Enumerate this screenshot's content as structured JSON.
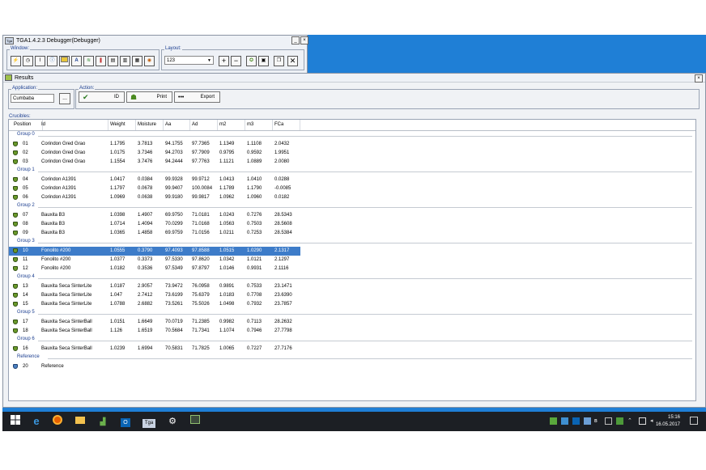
{
  "debugger": {
    "title": "TGA1.4.2.3 Debugger(Debugger)",
    "window_group_label": "Window:",
    "layout_group_label": "Layout:",
    "layout_value": "123",
    "toolbar_icons": [
      "lightning-icon",
      "clock-icon",
      "chart-icon",
      "info-icon",
      "yellow-box-icon",
      "text-a-icon",
      "signal-icon",
      "thermometer-icon",
      "page-icon",
      "document-icon",
      "document-list-icon",
      "gauge-icon"
    ],
    "layout_icons": [
      "plus-icon",
      "minus-icon",
      "gear-icon",
      "window-icon",
      "cascade-icon",
      "close-x-icon"
    ]
  },
  "results": {
    "title": "Results",
    "application_label": "Application:",
    "application_value": "Cumbaba",
    "application_button": "...",
    "action_label": "Action:",
    "actions": [
      {
        "icon": "checkmark-icon",
        "label": "ID"
      },
      {
        "icon": "printer-icon",
        "label": "Print"
      },
      {
        "icon": "ellipsis-icon",
        "label": "Export"
      }
    ],
    "crucibles_label": "Crucibles:",
    "columns": [
      "Position",
      "Id",
      "Weight",
      "Moisture",
      "Aa",
      "Ad",
      "m2",
      "m3",
      "FCa"
    ],
    "groups": [
      {
        "name": "Group 0",
        "rows": [
          [
            "01",
            "Corindon Gred Grao",
            "1.1795",
            "3.7813",
            "94.1755",
            "97.7365",
            "1.1349",
            "1.1108",
            "2.0432"
          ],
          [
            "02",
            "Corindon Gred Grao",
            "1.0175",
            "3.7346",
            "94.2703",
            "97.7909",
            "0.9795",
            "0.9592",
            "1.9951"
          ],
          [
            "03",
            "Corindon Gred Grao",
            "1.1554",
            "3.7476",
            "94.2444",
            "97.7763",
            "1.1121",
            "1.0889",
            "2.0080"
          ]
        ]
      },
      {
        "name": "Group 1",
        "rows": [
          [
            "04",
            "Corindon A1391",
            "1.0417",
            "0.0384",
            "99.9328",
            "99.9712",
            "1.0413",
            "1.0410",
            "0.0288"
          ],
          [
            "05",
            "Corindon A1391",
            "1.1797",
            "0.0678",
            "99.9407",
            "100.0084",
            "1.1789",
            "1.1790",
            "-0.0085"
          ],
          [
            "06",
            "Corindon A1391",
            "1.0969",
            "0.0638",
            "99.9180",
            "99.9817",
            "1.0962",
            "1.0960",
            "0.0182"
          ]
        ]
      },
      {
        "name": "Group 2",
        "rows": [
          [
            "07",
            "Bauxita B3",
            "1.0398",
            "1.4907",
            "69.9750",
            "71.0181",
            "1.0243",
            "0.7276",
            "28.5343"
          ],
          [
            "08",
            "Bauxita B3",
            "1.0714",
            "1.4094",
            "70.0299",
            "71.0168",
            "1.0563",
            "0.7503",
            "28.5608"
          ],
          [
            "09",
            "Bauxita B3",
            "1.0365",
            "1.4858",
            "69.9759",
            "71.0156",
            "1.0211",
            "0.7253",
            "28.5384"
          ]
        ]
      },
      {
        "name": "Group 3",
        "rows": [
          [
            "10",
            "Fonolito #200",
            "1.0555",
            "0.3790",
            "97.4093",
            "97.8588",
            "1.0515",
            "1.0290",
            "2.1317"
          ],
          [
            "11",
            "Fonolito #200",
            "1.0377",
            "0.3373",
            "97.5330",
            "97.8620",
            "1.0342",
            "1.0121",
            "2.1297"
          ],
          [
            "12",
            "Fonolito #200",
            "1.0182",
            "0.3536",
            "97.5349",
            "97.8797",
            "1.0146",
            "0.9931",
            "2.1116"
          ]
        ]
      },
      {
        "name": "Group 4",
        "rows": [
          [
            "13",
            "Bauxita Seca SinterLite",
            "1.0187",
            "2.9057",
            "73.9472",
            "76.0958",
            "0.9891",
            "0.7533",
            "23.1471"
          ],
          [
            "14",
            "Bauxita Seca SinterLite",
            "1.047",
            "2.7412",
            "73.6199",
            "75.6379",
            "1.0183",
            "0.7708",
            "23.6390"
          ],
          [
            "15",
            "Bauxita Seca SinterLite",
            "1.0788",
            "2.6882",
            "73.5261",
            "75.5026",
            "1.0498",
            "0.7932",
            "23.7857"
          ]
        ]
      },
      {
        "name": "Group 5",
        "rows": [
          [
            "17",
            "Bauxita Seca SinterBall",
            "1.0151",
            "1.6649",
            "70.0719",
            "71.2385",
            "0.9982",
            "0.7113",
            "28.2632"
          ],
          [
            "18",
            "Bauxita Seca SinterBall",
            "1.126",
            "1.6519",
            "70.5684",
            "71.7341",
            "1.1074",
            "0.7946",
            "27.7798"
          ]
        ]
      },
      {
        "name": "Group 6",
        "rows": [
          [
            "16",
            "Bauxita Seca SinterBall",
            "1.0239",
            "1.6994",
            "70.5831",
            "71.7825",
            "1.0065",
            "0.7227",
            "27.7176"
          ]
        ]
      },
      {
        "name": "Reference",
        "rows": [
          [
            "20",
            "Reference",
            "",
            "",
            "",
            "",
            "",
            "",
            ""
          ]
        ]
      }
    ],
    "selected_position": "10"
  },
  "taskbar": {
    "apps": [
      "windows-logo-icon",
      "edge-icon",
      "firefox-icon",
      "file-explorer-icon",
      "chart-app-icon",
      "outlook-icon",
      "tga-app-icon",
      "settings-icon",
      "tga-monitor-icon"
    ],
    "tga_label": "Tga",
    "time": "15:16",
    "date": "16.05.2017"
  }
}
